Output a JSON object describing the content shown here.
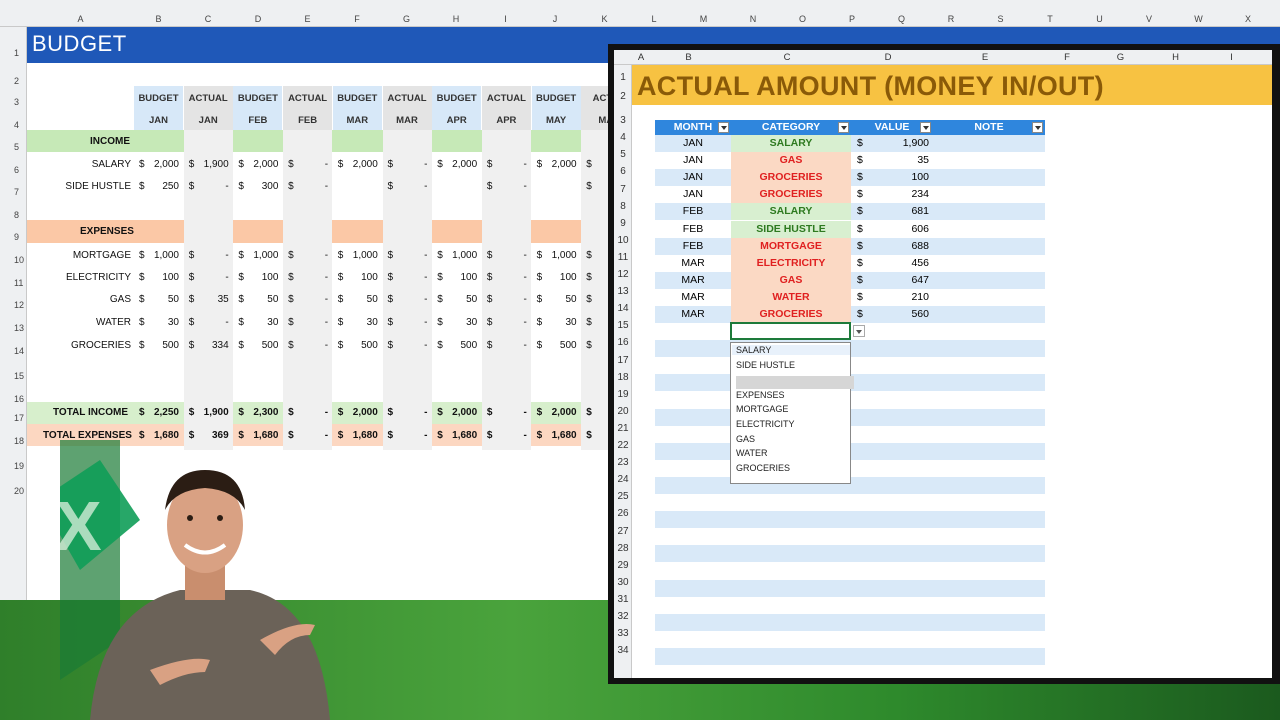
{
  "budget_sheet": {
    "title": "BUDGET",
    "columns": [
      "A",
      "B",
      "C",
      "D",
      "E",
      "F",
      "G",
      "H",
      "I",
      "J",
      "K",
      "L",
      "M",
      "N",
      "O",
      "P",
      "Q",
      "R",
      "S",
      "T",
      "U",
      "V",
      "W",
      "X"
    ],
    "header_top": [
      "BUDGET",
      "ACTUAL",
      "BUDGET",
      "ACTUAL",
      "BUDGET",
      "ACTUAL",
      "BUDGET",
      "ACTUAL",
      "BUDGET",
      "ACTU"
    ],
    "header_months": [
      "JAN",
      "JAN",
      "FEB",
      "FEB",
      "MAR",
      "MAR",
      "APR",
      "APR",
      "MAY",
      "MA"
    ],
    "income_label": "INCOME",
    "expenses_label": "EXPENSES",
    "total_income_label": "TOTAL INCOME",
    "total_expenses_label": "TOTAL EXPENSES",
    "rows": [
      {
        "label": "SALARY",
        "values": [
          "$ 2,000",
          "$ 1,900",
          "$ 2,000",
          "$ -",
          "$ 2,000",
          "$ -",
          "$ 2,000",
          "$ -",
          "$ 2,000",
          "$"
        ]
      },
      {
        "label": "SIDE HUSTLE",
        "values": [
          "$ 250",
          "$ -",
          "$ 300",
          "$ -",
          "",
          "$ -",
          "",
          "$ -",
          "",
          "$"
        ]
      },
      {
        "label": "MORTGAGE",
        "values": [
          "$ 1,000",
          "$ -",
          "$ 1,000",
          "$ -",
          "$ 1,000",
          "$ -",
          "$ 1,000",
          "$ -",
          "$ 1,000",
          "$"
        ]
      },
      {
        "label": "ELECTRICITY",
        "values": [
          "$ 100",
          "$ -",
          "$ 100",
          "$ -",
          "$ 100",
          "$ -",
          "$ 100",
          "$ -",
          "$ 100",
          "$"
        ]
      },
      {
        "label": "GAS",
        "values": [
          "$ 50",
          "$ 35",
          "$ 50",
          "$ -",
          "$ 50",
          "$ -",
          "$ 50",
          "$ -",
          "$ 50",
          "$"
        ]
      },
      {
        "label": "WATER",
        "values": [
          "$ 30",
          "$ -",
          "$ 30",
          "$ -",
          "$ 30",
          "$ -",
          "$ 30",
          "$ -",
          "$ 30",
          "$"
        ]
      },
      {
        "label": "GROCERIES",
        "values": [
          "$ 500",
          "$ 334",
          "$ 500",
          "$ -",
          "$ 500",
          "$ -",
          "$ 500",
          "$ -",
          "$ 500",
          "$"
        ]
      }
    ],
    "total_income": [
      "$ 2,250",
      "$ 1,900",
      "$ 2,300",
      "$ -",
      "$ 2,000",
      "$ -",
      "$ 2,000",
      "$ -",
      "$ 2,000",
      "$"
    ],
    "total_expenses": [
      "$ 1,680",
      "$ 369",
      "$ 1,680",
      "$ -",
      "$ 1,680",
      "$ -",
      "$ 1,680",
      "$ -",
      "$ 1,680",
      "$"
    ],
    "row_numbers": [
      "1",
      "2",
      "3",
      "4",
      "5",
      "6",
      "7",
      "8",
      "9",
      "10",
      "11",
      "12",
      "13",
      "14",
      "15",
      "16",
      "17",
      "18",
      "19",
      "20"
    ]
  },
  "actual_sheet": {
    "title": "ACTUAL AMOUNT (MONEY IN/OUT)",
    "columns": [
      "A",
      "B",
      "C",
      "D",
      "E",
      "F",
      "G",
      "H",
      "I"
    ],
    "headers": {
      "month": "MONTH",
      "category": "CATEGORY",
      "value": "VALUE",
      "note": "NOTE"
    },
    "rows": [
      {
        "month": "JAN",
        "category": "SALARY",
        "type": "income",
        "value": "1,900"
      },
      {
        "month": "JAN",
        "category": "GAS",
        "type": "expense",
        "value": "35"
      },
      {
        "month": "JAN",
        "category": "GROCERIES",
        "type": "expense",
        "value": "100"
      },
      {
        "month": "JAN",
        "category": "GROCERIES",
        "type": "expense",
        "value": "234"
      },
      {
        "month": "FEB",
        "category": "SALARY",
        "type": "income",
        "value": "681"
      },
      {
        "month": "FEB",
        "category": "SIDE HUSTLE",
        "type": "income",
        "value": "606"
      },
      {
        "month": "FEB",
        "category": "MORTGAGE",
        "type": "expense",
        "value": "688"
      },
      {
        "month": "MAR",
        "category": "ELECTRICITY",
        "type": "expense",
        "value": "456"
      },
      {
        "month": "MAR",
        "category": "GAS",
        "type": "expense",
        "value": "647"
      },
      {
        "month": "MAR",
        "category": "WATER",
        "type": "expense",
        "value": "210"
      },
      {
        "month": "MAR",
        "category": "GROCERIES",
        "type": "expense",
        "value": "560"
      }
    ],
    "currency": "$",
    "dropdown_options": [
      "SALARY",
      "SIDE HUSTLE",
      "",
      "EXPENSES",
      "MORTGAGE",
      "ELECTRICITY",
      "GAS",
      "WATER",
      "GROCERIES"
    ],
    "row_numbers": [
      "1",
      "2",
      "3",
      "4",
      "5",
      "6",
      "7",
      "8",
      "9",
      "10",
      "11",
      "12",
      "13",
      "14",
      "15",
      "16",
      "17",
      "18",
      "19",
      "20",
      "21",
      "22",
      "23",
      "24",
      "25",
      "26",
      "27",
      "28",
      "29",
      "30",
      "31",
      "32",
      "33",
      "34"
    ]
  },
  "colors": {
    "budget_title_bg": "#1f58b8",
    "actual_title_bg": "#f7c242",
    "table_header": "#2f86dd",
    "income_band": "#c6e9b7",
    "expense_band": "#fbc8a6",
    "budget_header": "#d7e8f8"
  }
}
